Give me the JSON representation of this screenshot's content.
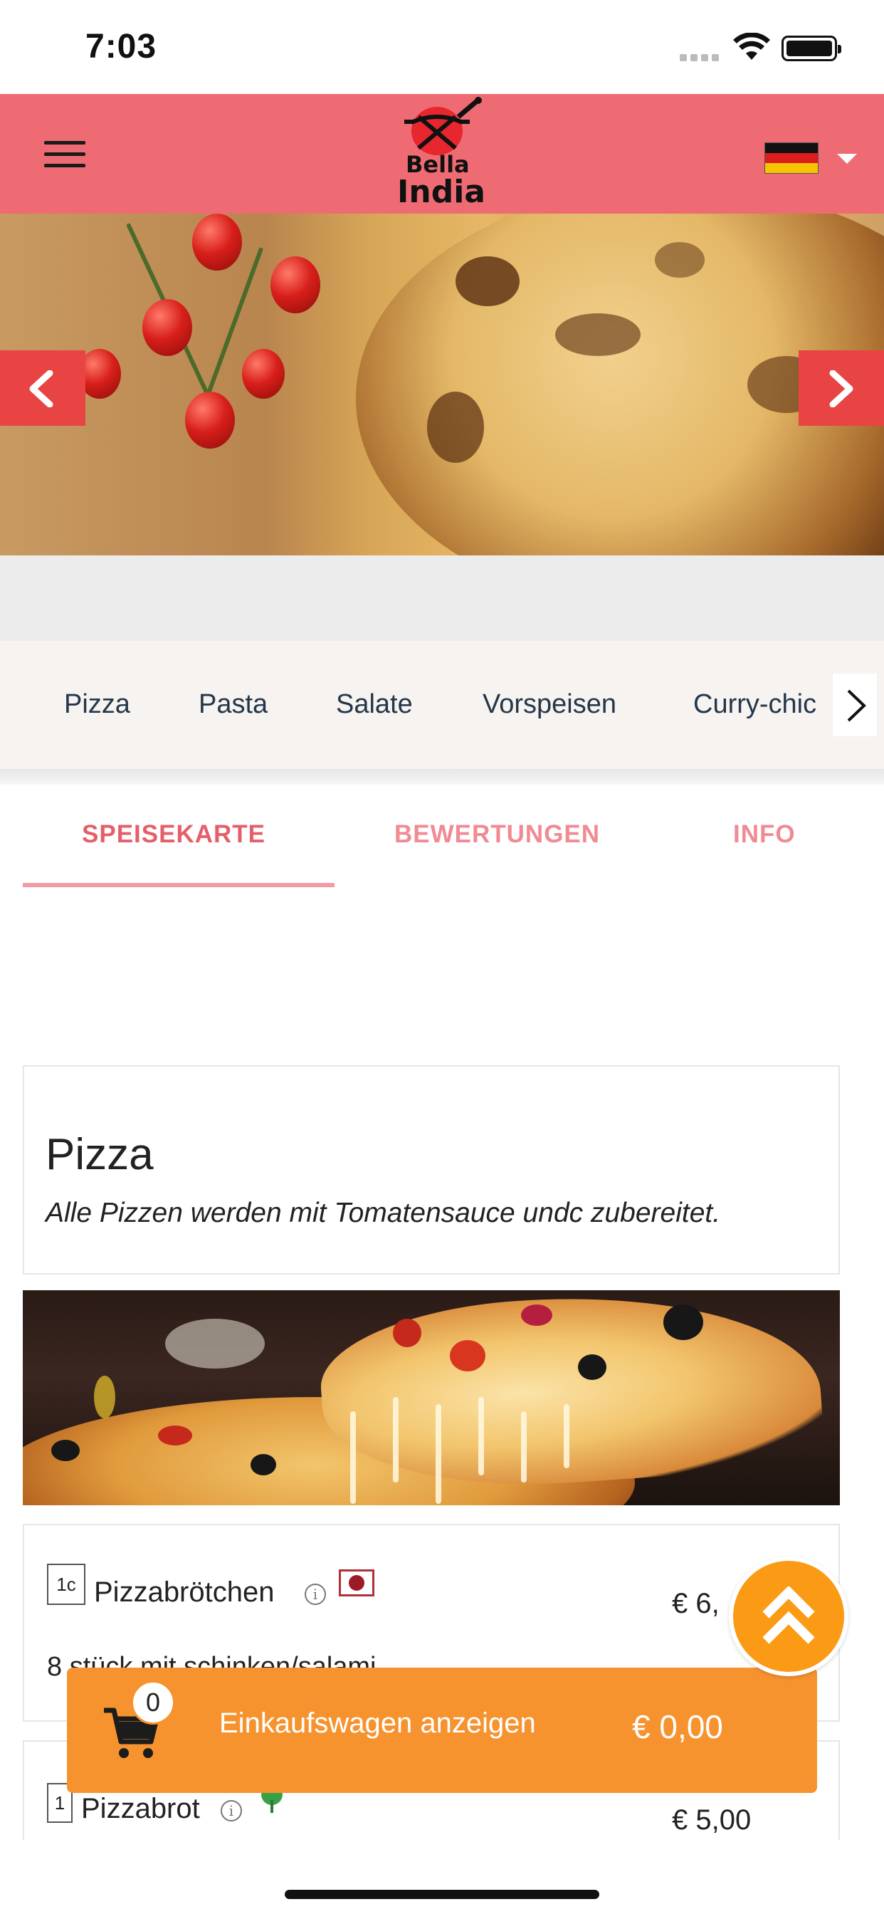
{
  "status_bar": {
    "time": "7:03"
  },
  "header": {
    "logo": {
      "line1": "Bella",
      "line2": "India"
    },
    "language_flag": "de"
  },
  "colors": {
    "header": "#ef6b74",
    "slider_button": "#e84444",
    "cart_bar": "#f7932f",
    "scroll_top": "#fb9a15",
    "tab_active": "#e45f6a"
  },
  "categories": [
    "Pizza",
    "Pasta",
    "Salate",
    "Vorspeisen",
    "Curry-chic"
  ],
  "tabs": {
    "menu": "SPEISEKARTE",
    "reviews": "BEWERTUNGEN",
    "info": "INFO"
  },
  "section": {
    "title": "Pizza",
    "subtitle": "Alle Pizzen werden mit Tomatensauce undc zubereitet."
  },
  "items": [
    {
      "number": "1c",
      "name": "Pizzabrötchen",
      "price": "€ 6,",
      "description": "8 stück mit schinken/salami",
      "allergen_icon": "allergen-badge",
      "info_icon": "info-icon"
    },
    {
      "number": "1",
      "name": "Pizzabrot",
      "price": "€ 5,00",
      "veg_icon": "tree-icon",
      "info_icon": "info-icon"
    }
  ],
  "cart": {
    "count": "0",
    "label": "Einkaufswagen anzeigen",
    "total": "€ 0,00"
  }
}
